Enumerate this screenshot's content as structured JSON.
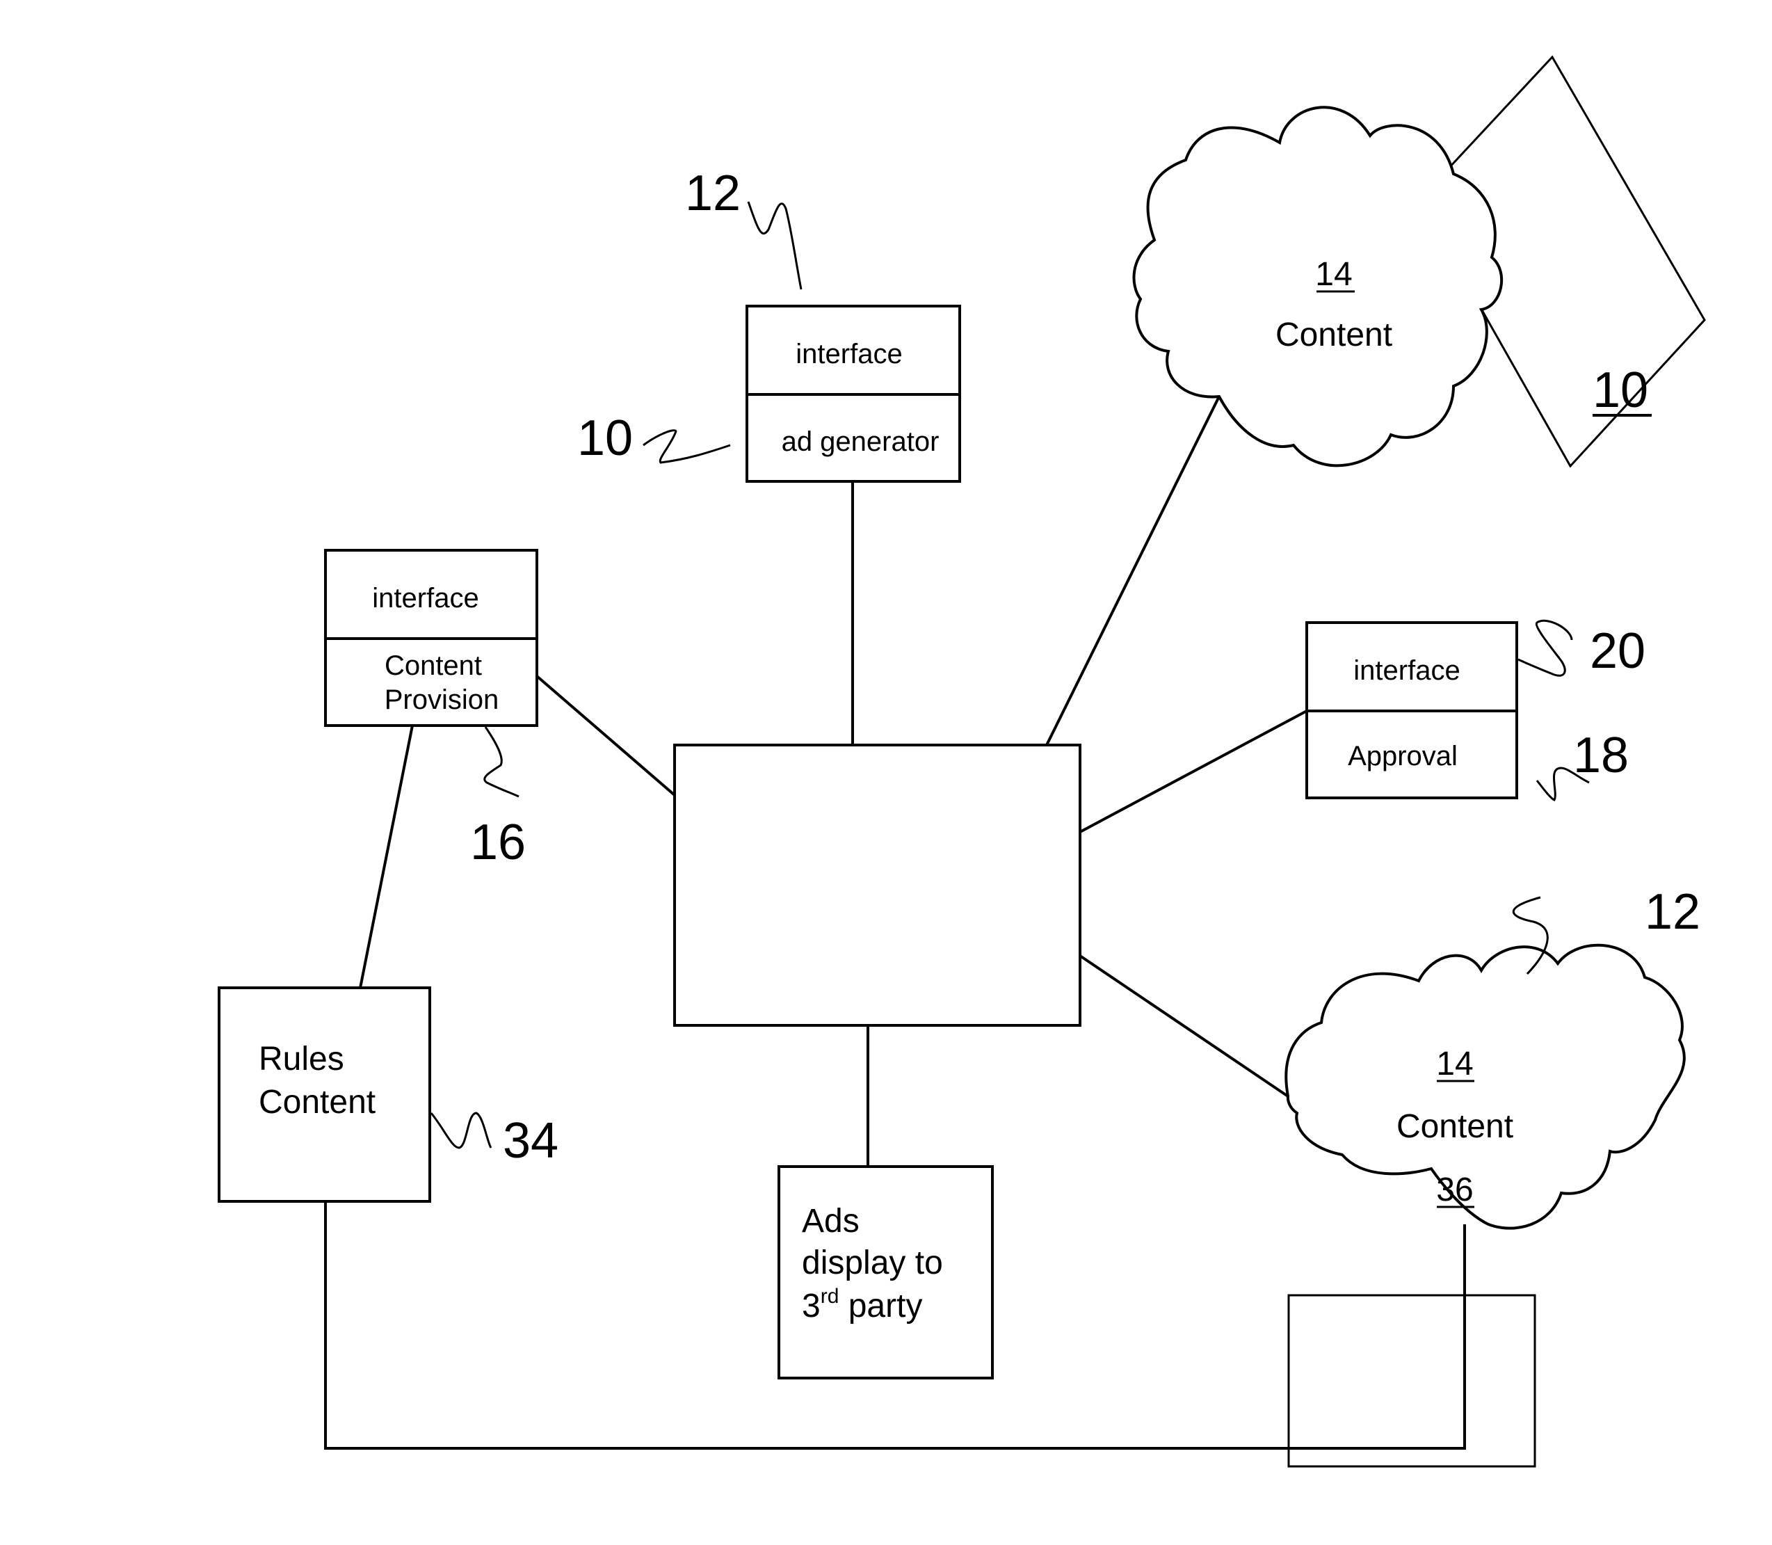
{
  "diagram": {
    "ad_generator": {
      "top": "interface",
      "bottom": "ad generator",
      "refs": [
        "12",
        "10"
      ]
    },
    "content_provision": {
      "top": "interface",
      "bottom_line1": "Content",
      "bottom_line2": "Provision",
      "ref": "16"
    },
    "approval": {
      "top": "interface",
      "bottom": "Approval",
      "refs": [
        "20",
        "18"
      ]
    },
    "rules_content": {
      "line1": "Rules",
      "line2": "Content",
      "ref": "34"
    },
    "ads_display": {
      "line1": "Ads",
      "line2": "display to",
      "line3_num": "3",
      "line3_sup": "rd",
      "line3_rest": " party"
    },
    "cloud_top": {
      "number": "14",
      "label": "Content"
    },
    "cloud_bottom": {
      "number": "14",
      "label": "Content",
      "number2": "36",
      "ref": "12"
    },
    "figure_ref": "10"
  }
}
